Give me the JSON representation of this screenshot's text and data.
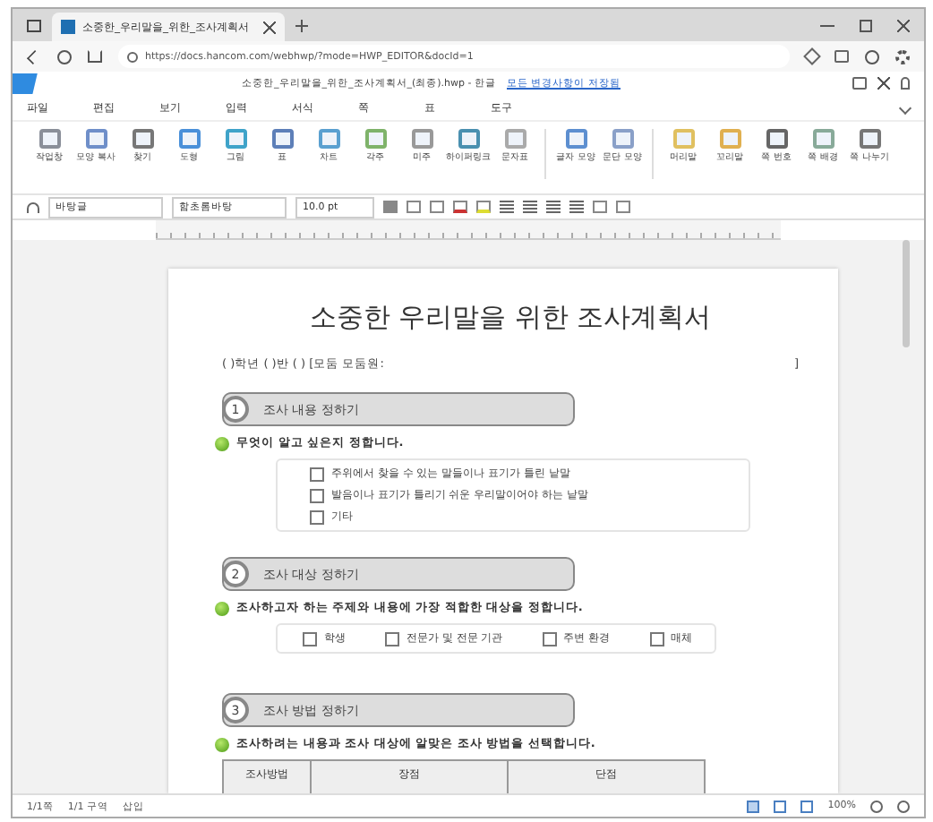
{
  "browser": {
    "tab_title": "소중한_우리말을_위한_조사계획서",
    "url": "https://docs.hancom.com/webhwp/?mode=HWP_EDITOR&docId=1"
  },
  "app": {
    "doc_title": "소중한_우리말을_위한_조사계획서_(최종).hwp - 한글",
    "save_status": "모든 변경사항이 저장됨"
  },
  "menu": [
    "파일",
    "편집",
    "보기",
    "입력",
    "서식",
    "쪽",
    "표",
    "도구"
  ],
  "ribbon": [
    {
      "label": "작업창"
    },
    {
      "label": "모양 복사"
    },
    {
      "label": "찾기"
    },
    {
      "label": "도형"
    },
    {
      "label": "그림"
    },
    {
      "label": "표"
    },
    {
      "label": "차트"
    },
    {
      "label": "각주"
    },
    {
      "label": "미주"
    },
    {
      "label": "하이퍼링크"
    },
    {
      "label": "문자표"
    },
    {
      "label": "글자 모양"
    },
    {
      "label": "문단 모양"
    },
    {
      "label": "머리말"
    },
    {
      "label": "꼬리말"
    },
    {
      "label": "쪽 번호"
    },
    {
      "label": "쪽 배경"
    },
    {
      "label": "쪽 나누기"
    }
  ],
  "format_bar": {
    "style": "바탕글",
    "font": "함초롬바탕",
    "size": "10.0 pt"
  },
  "document": {
    "title": "소중한 우리말을 위한 조사계획서",
    "info": "(   )학년 (   )반 (   )   [모둠  모둠원:",
    "info_end": "]",
    "sections": [
      {
        "number": "1",
        "heading": "조사 내용 정하기",
        "instruction": "무엇이 알고 싶은지 정합니다.",
        "kind": "list",
        "options": [
          {
            "label": "주위에서 찾을 수 있는 말들이나 표기가 틀린 낱말",
            "checked": false
          },
          {
            "label": "발음이나 표기가 틀리기 쉬운 우리말이어야 하는 낱말",
            "checked": false
          },
          {
            "label": "기타",
            "checked": false
          }
        ]
      },
      {
        "number": "2",
        "heading": "조사 대상 정하기",
        "instruction": "조사하고자 하는 주제와 내용에 가장 적합한 대상을 정합니다.",
        "kind": "row",
        "options": [
          {
            "label": "학생",
            "checked": false
          },
          {
            "label": "전문가 및 전문 기관",
            "checked": false
          },
          {
            "label": "주변 환경",
            "checked": false
          },
          {
            "label": "매체",
            "checked": false
          }
        ]
      },
      {
        "number": "3",
        "heading": "조사 방법 정하기",
        "instruction": "조사하려는 내용과 조사 대상에 알맞은 조사 방법을 선택합니다.",
        "kind": "table",
        "columns": [
          "조사방법",
          "장점",
          "단점"
        ]
      }
    ]
  },
  "status": {
    "page": "1/1쪽",
    "section": "1/1 구역",
    "mode": "삽입",
    "zoom": "100%"
  }
}
